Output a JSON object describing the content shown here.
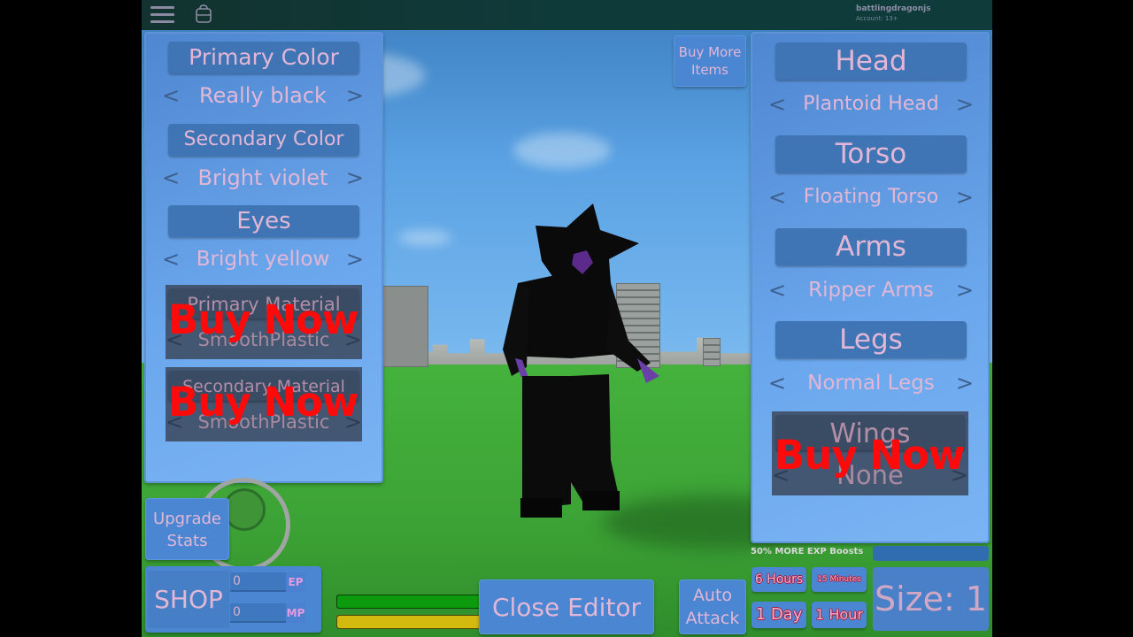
{
  "topbar": {
    "menu_icon": "hamburger-menu-icon",
    "backpack_icon": "backpack-icon",
    "username": "battlingdragonjs",
    "account_label": "Account: 13+"
  },
  "left_panel": {
    "primary_color": {
      "label": "Primary Color",
      "value": "Really black"
    },
    "secondary_color": {
      "label": "Secondary Color",
      "value": "Bright violet"
    },
    "eyes": {
      "label": "Eyes",
      "value": "Bright yellow"
    },
    "primary_material": {
      "label": "Primary Material",
      "value": "SmoothPlastic",
      "overlay": "Buy Now",
      "locked": true
    },
    "secondary_material": {
      "label": "Secondary Material",
      "value": "SmoothPlastic",
      "overlay": "Buy Now",
      "locked": true
    },
    "prev_arrow": "<",
    "next_arrow": ">"
  },
  "right_panel": {
    "head": {
      "label": "Head",
      "value": "Plantoid Head"
    },
    "torso": {
      "label": "Torso",
      "value": "Floating Torso"
    },
    "arms": {
      "label": "Arms",
      "value": "Ripper Arms"
    },
    "legs": {
      "label": "Legs",
      "value": "Normal Legs"
    },
    "wings": {
      "label": "Wings",
      "value": "None",
      "overlay": "Buy Now",
      "locked": true
    }
  },
  "buttons": {
    "buy_more_items": "Buy More Items",
    "upgrade_stats": "Upgrade Stats",
    "shop": "SHOP",
    "close_editor": "Close Editor",
    "auto_attack": "Auto Attack"
  },
  "currency": {
    "ep": {
      "value": "0",
      "unit": "EP"
    },
    "mp": {
      "value": "0",
      "unit": "MP"
    }
  },
  "bars": {
    "health": {
      "color": "#0d9a0d",
      "fill_percent": 100
    },
    "energy": {
      "color": "#d4b90e",
      "fill_percent": 100
    }
  },
  "boosts": {
    "label": "50% MORE EXP Boosts",
    "options": [
      "6 Hours",
      "15 Minutes",
      "1 Day",
      "1 Hour"
    ]
  },
  "size": {
    "label": "Size: 1"
  },
  "colors": {
    "panel": "#6aa6ec",
    "header": "#3f75b5",
    "text": "#e2b7d6",
    "buy_now": "#ff0a0a",
    "ground": "#41a63a",
    "sky": "#5aa2e4"
  }
}
